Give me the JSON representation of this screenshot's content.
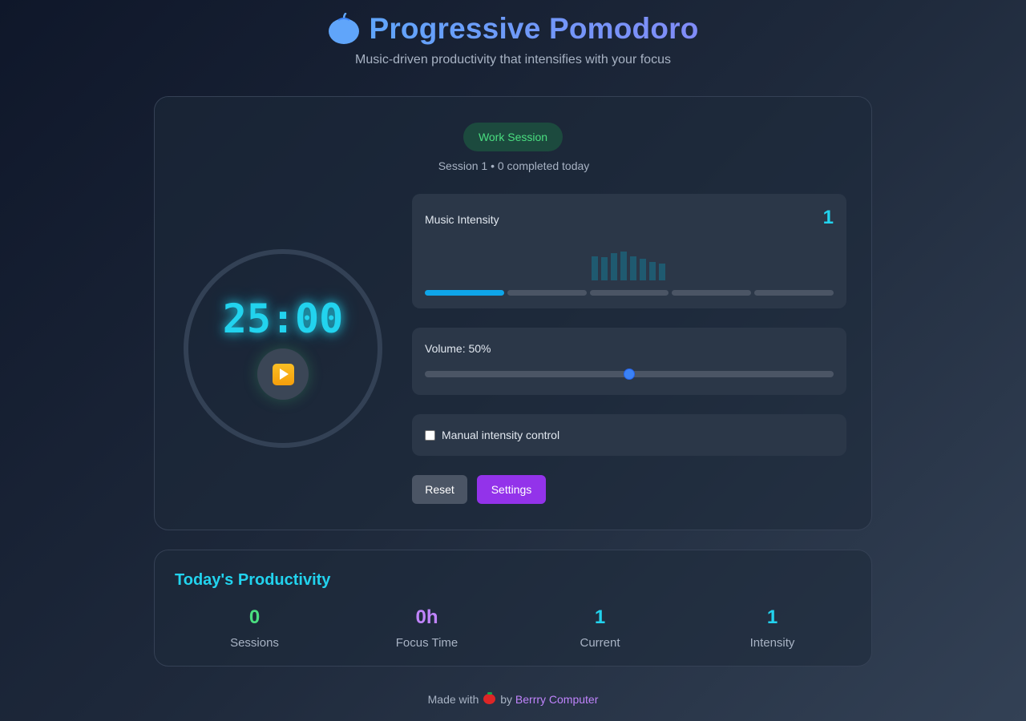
{
  "header": {
    "title": "Progressive Pomodoro",
    "subtitle": "Music-driven productivity that intensifies with your focus",
    "logo_icon": "tomato-icon",
    "title_gradient": [
      "#60a5fa",
      "#818cf8"
    ]
  },
  "session": {
    "badge": "Work Session",
    "info": "Session 1 • 0 completed today",
    "badge_color": "#4ade80"
  },
  "timer": {
    "display": "25:00",
    "play_icon": "play-icon",
    "color": "#22d3ee"
  },
  "intensity": {
    "label": "Music Intensity",
    "value": "1",
    "level": 1,
    "max_level": 5,
    "visualizer_levels": [
      0.8,
      0.75,
      0.9,
      0.95,
      0.8,
      0.7,
      0.6,
      0.55
    ]
  },
  "volume": {
    "label": "Volume: 50%",
    "percent": 50
  },
  "manual": {
    "label": "Manual intensity control",
    "checked": false
  },
  "controls": {
    "reset_label": "Reset",
    "settings_label": "Settings",
    "settings_color": "#9333ea"
  },
  "stats": {
    "title": "Today's Productivity",
    "items": [
      {
        "value": "0",
        "label": "Sessions",
        "color": "#4ade80"
      },
      {
        "value": "0h",
        "label": "Focus Time",
        "color": "#c084fc"
      },
      {
        "value": "1",
        "label": "Current",
        "color": "#22d3ee"
      },
      {
        "value": "1",
        "label": "Intensity",
        "color": "#22d3ee"
      }
    ]
  },
  "footer": {
    "prefix": "Made with",
    "emoji_icon": "tomato-emoji-icon",
    "by": "by",
    "link_text": "Berrry Computer"
  }
}
